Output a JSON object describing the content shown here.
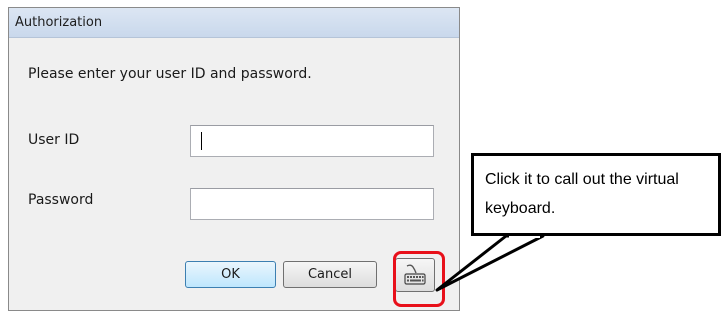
{
  "dialog": {
    "title": "Authorization",
    "prompt": "Please enter your user ID and password.",
    "user_id_label": "User ID",
    "user_id_value": "",
    "password_label": "Password",
    "password_value": "",
    "ok_label": "OK",
    "cancel_label": "Cancel",
    "keyboard_icon": "virtual-keyboard-icon"
  },
  "callout": {
    "text": "Click it to call out the virtual keyboard."
  },
  "colors": {
    "highlight": "#e8101a",
    "callout_border": "#000000",
    "ok_accent": "#3c7fb1"
  }
}
